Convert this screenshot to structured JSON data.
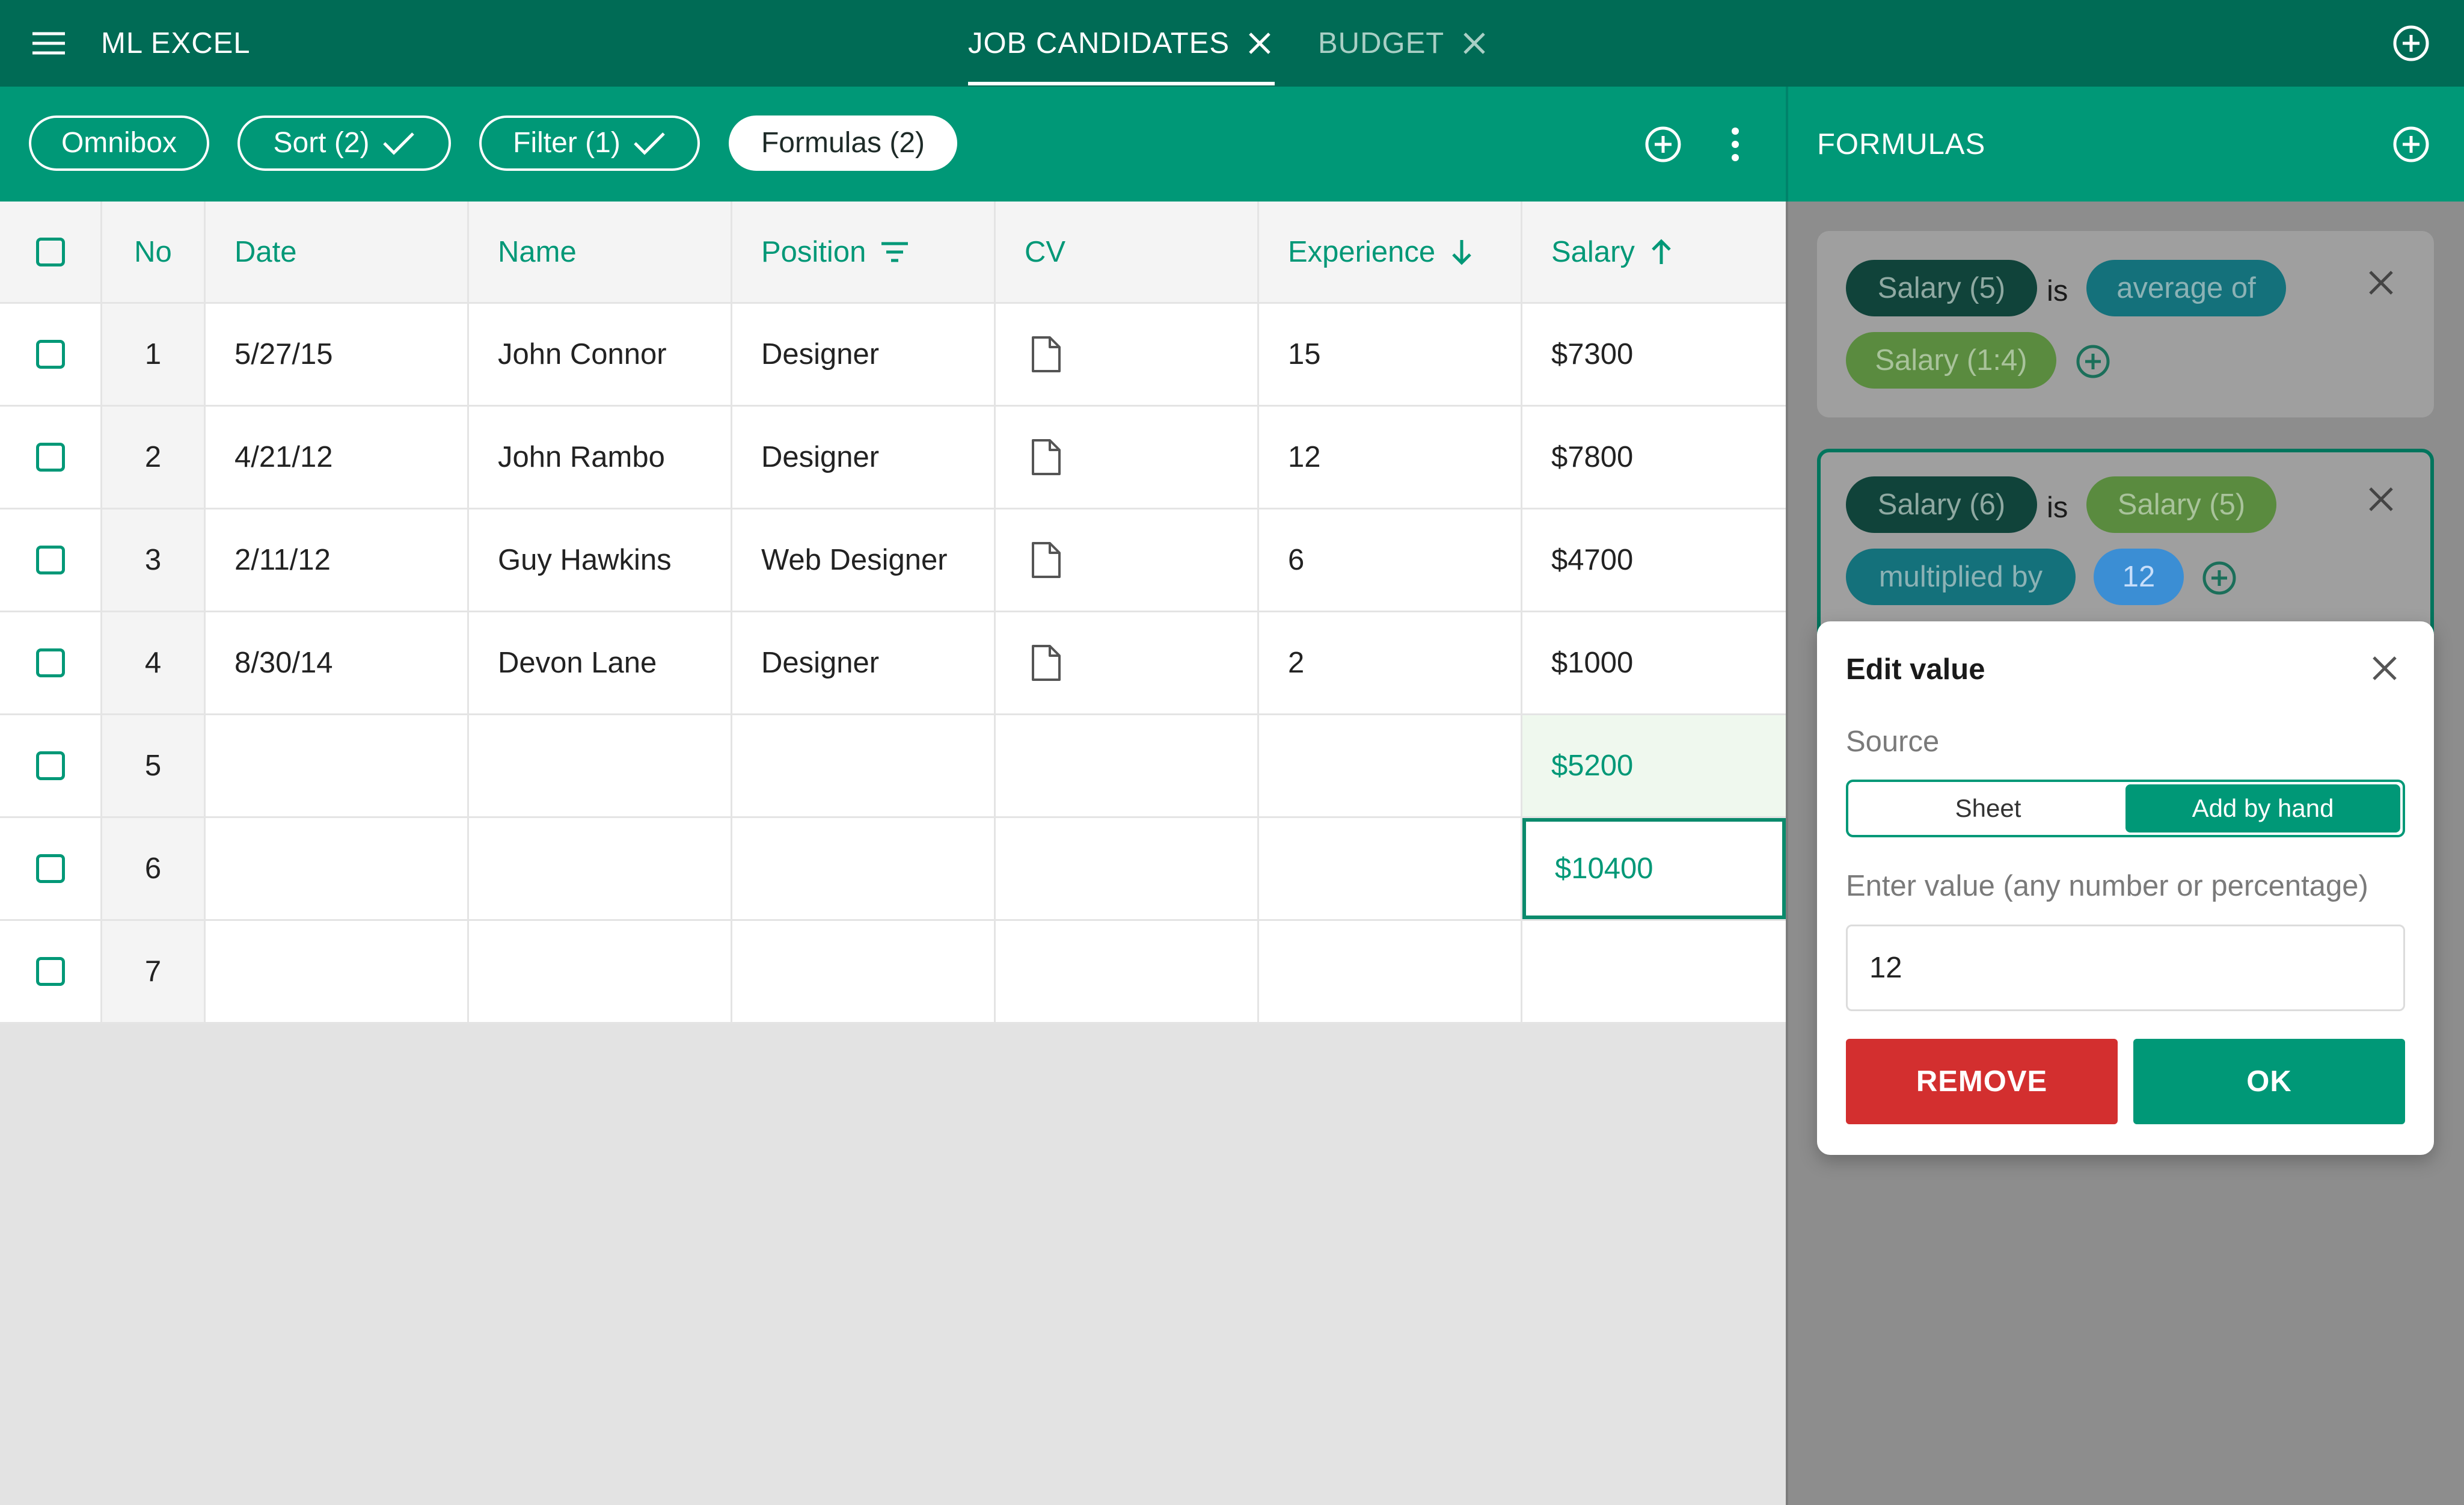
{
  "app": {
    "title": "ML EXCEL"
  },
  "tabs": [
    {
      "label": "JOB CANDIDATES",
      "active": true
    },
    {
      "label": "BUDGET",
      "active": false
    }
  ],
  "toolbar": {
    "chips": [
      {
        "label": "Omnibox",
        "checked": false
      },
      {
        "label": "Sort (2)",
        "checked": true
      },
      {
        "label": "Filter (1)",
        "checked": true
      },
      {
        "label": "Formulas (2)",
        "selected": true
      }
    ]
  },
  "table": {
    "headers": [
      "No",
      "Date",
      "Name",
      "Position",
      "CV",
      "Experience",
      "Salary"
    ],
    "rows": [
      {
        "no": "1",
        "date": "5/27/15",
        "name": "John Connor",
        "position": "Designer",
        "cv": "file-icon",
        "experience": "15",
        "salary": "$7300"
      },
      {
        "no": "2",
        "date": "4/21/12",
        "name": "John Rambo",
        "position": "Designer",
        "cv": "file-icon",
        "experience": "12",
        "salary": "$7800"
      },
      {
        "no": "3",
        "date": "2/11/12",
        "name": "Guy Hawkins",
        "position": "Web Designer",
        "cv": "file-icon",
        "experience": "6",
        "salary": "$4700"
      },
      {
        "no": "4",
        "date": "8/30/14",
        "name": "Devon Lane",
        "position": "Designer",
        "cv": "file-icon",
        "experience": "2",
        "salary": "$1000"
      },
      {
        "no": "5",
        "date": "",
        "name": "",
        "position": "",
        "cv": "",
        "experience": "",
        "salary": "$5200"
      },
      {
        "no": "6",
        "date": "",
        "name": "",
        "position": "",
        "cv": "",
        "experience": "",
        "salary": "$10400"
      },
      {
        "no": "7",
        "date": "",
        "name": "",
        "position": "",
        "cv": "",
        "experience": "",
        "salary": ""
      }
    ]
  },
  "formulas_panel": {
    "title": "FORMULAS",
    "formulas": [
      {
        "target": "Salary (5)",
        "is": "is",
        "operation": "average of",
        "operand": "Salary (1:4)"
      },
      {
        "target": "Salary (6)",
        "is": "is",
        "operand": "Salary (5)",
        "operation": "multiplied by",
        "value": "12"
      }
    ]
  },
  "edit_value": {
    "title": "Edit value",
    "source_label": "Source",
    "source_options": [
      "Sheet",
      "Add by hand"
    ],
    "selected_source": "Add by hand",
    "value_label": "Enter value (any number or percentage)",
    "value": "12",
    "remove_label": "REMOVE",
    "ok_label": "OK"
  },
  "colors": {
    "topbar": "#006b55",
    "toolbar": "#009877",
    "accent": "#009877",
    "remove": "#d32f2f"
  }
}
